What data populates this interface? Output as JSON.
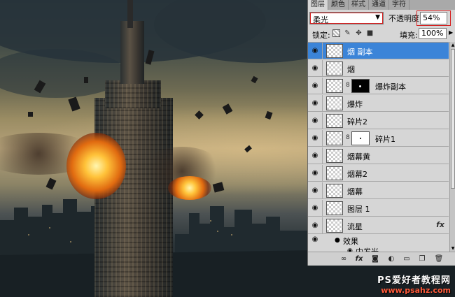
{
  "panel": {
    "tabs": [
      "图层",
      "颜色",
      "样式",
      "通道",
      "字符"
    ],
    "active_tab": 0,
    "blend_mode": "柔光",
    "opacity_label": "不透明度:",
    "opacity_value": "54%",
    "lock_label": "锁定:",
    "fill_label": "填充:",
    "fill_value": "100%",
    "layers": [
      {
        "name": "烟 副本",
        "selected": true
      },
      {
        "name": "烟"
      },
      {
        "name": "爆炸副本",
        "mask": "black"
      },
      {
        "name": "爆炸"
      },
      {
        "name": "碎片2"
      },
      {
        "name": "碎片1",
        "mask": "white"
      },
      {
        "name": "烟幕黄"
      },
      {
        "name": "烟幕2"
      },
      {
        "name": "烟幕"
      },
      {
        "name": "图层 1"
      },
      {
        "name": "流星",
        "fx": "fx"
      }
    ],
    "effects_label": "效果",
    "effect_item": "内发光"
  },
  "watermark": {
    "line1": "PS爱好者教程网",
    "line2": "www.psahz.com"
  },
  "icons": {
    "eye": "eye-icon",
    "chain": "chain-link-icon",
    "lock_transparent": "checkerboard-lock-icon",
    "lock_paint": "brush-lock-icon",
    "lock_move": "move-lock-icon",
    "lock_all": "padlock-icon"
  }
}
